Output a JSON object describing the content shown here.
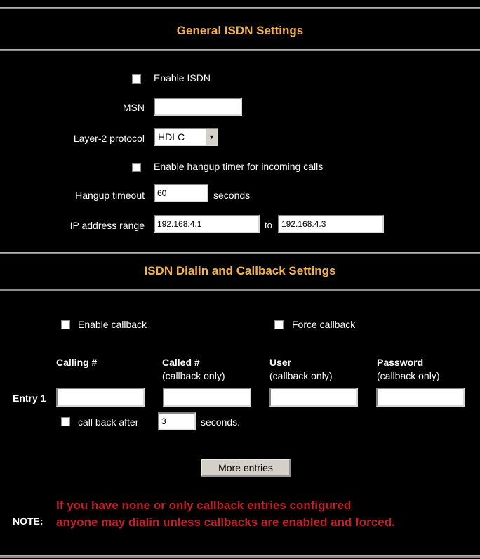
{
  "general": {
    "title": "General ISDN Settings",
    "enable_isdn_label": "Enable ISDN",
    "enable_isdn_checked": false,
    "msn_label": "MSN",
    "msn_value": "",
    "layer2_label": "Layer-2 protocol",
    "layer2_value": "HDLC",
    "hangup_timer_label": "Enable hangup timer for incoming calls",
    "hangup_timer_checked": false,
    "hangup_timeout_label": "Hangup timeout",
    "hangup_timeout_value": "60",
    "seconds_label": "seconds",
    "ip_range_label": "IP address range",
    "ip_from": "192.168.4.1",
    "to_label": "to",
    "ip_to": "192.168.4.3"
  },
  "dialin": {
    "title": "ISDN Dialin and Callback Settings",
    "enable_callback_label": "Enable callback",
    "enable_callback_checked": false,
    "force_callback_label": "Force callback",
    "force_callback_checked": false,
    "columns": [
      {
        "header": "Calling #",
        "sub": ""
      },
      {
        "header": "Called #",
        "sub": "(callback only)"
      },
      {
        "header": "User",
        "sub": "(callback only)"
      },
      {
        "header": "Password",
        "sub": "(callback only)"
      }
    ],
    "entry_label": "Entry 1",
    "entry_values": [
      "",
      "",
      "",
      ""
    ],
    "call_back_after_label": "call back after",
    "call_back_after_value": "3",
    "call_back_seconds_label": "seconds.",
    "more_entries_label": "More entries"
  },
  "note": {
    "label": "NOTE:",
    "line1": "If you have none or only callback entries configured",
    "line2": "anyone may dialin unless callbacks are enabled and forced."
  },
  "colors": {
    "background": "#000000",
    "section_title": "#f6b24a",
    "note_text": "#c0202a",
    "rule": "#8a8a8a"
  }
}
